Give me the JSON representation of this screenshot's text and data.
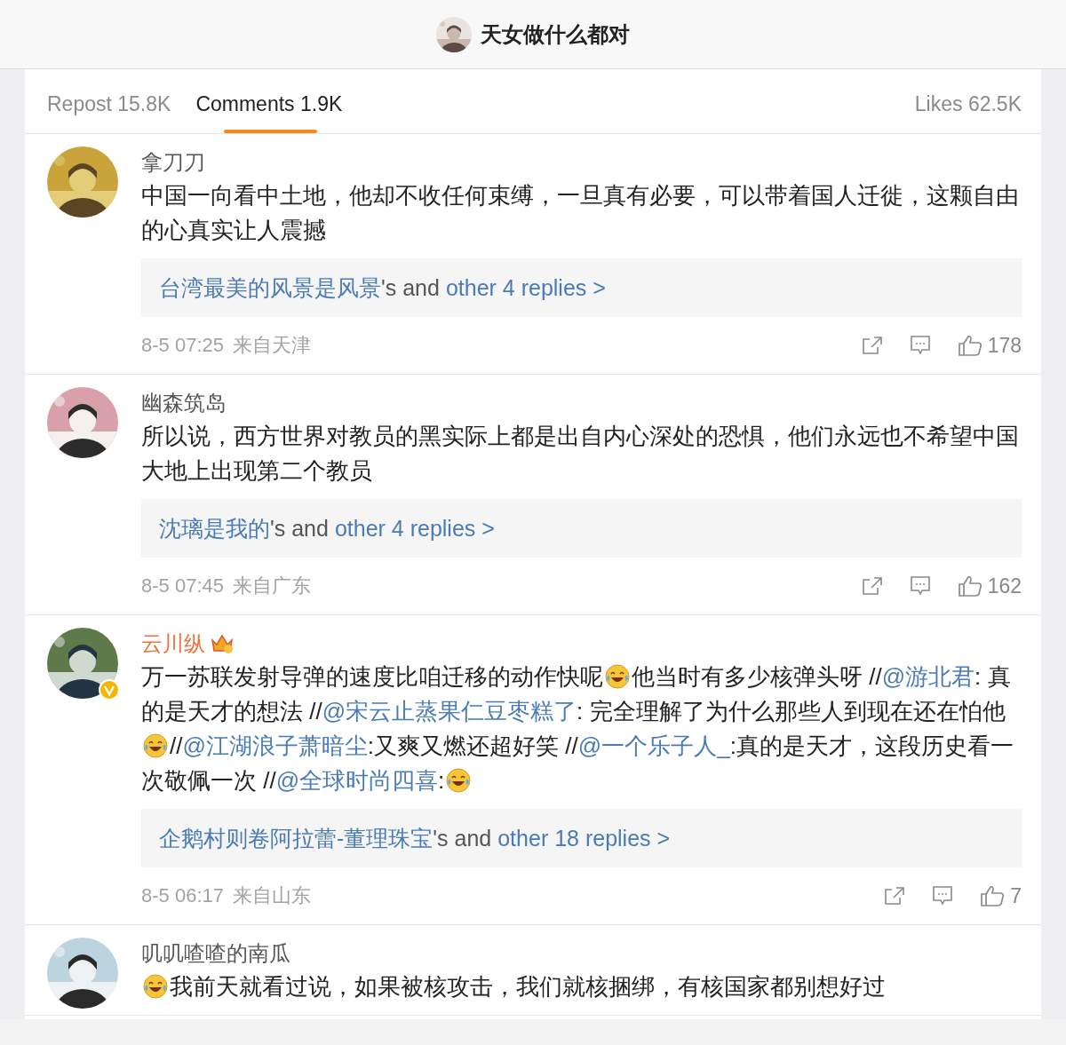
{
  "header": {
    "title": "天女做什么都对"
  },
  "tabs": [
    {
      "label": "Repost 15.8K",
      "selected": false
    },
    {
      "label": "Comments 1.9K",
      "selected": true
    },
    {
      "label": "Likes 62.5K",
      "selected": false
    }
  ],
  "comments": [
    {
      "user": "拿刀刀",
      "vip": false,
      "verified": false,
      "name_highlight": false,
      "body": [
        {
          "kind": "text",
          "text": "中国一向看中土地，他却不收任何束缚，一旦真有必要，可以带着国人迁徙，这颗自由的心真实让人震撼"
        }
      ],
      "replies": {
        "user": "台湾最美的风景是风景",
        "joiner": "'s and",
        "link": "other 4 replies >"
      },
      "time": "8-5 07:25",
      "source": "来自天津",
      "likes": "178"
    },
    {
      "user": "幽森筑岛",
      "vip": false,
      "verified": false,
      "name_highlight": false,
      "body": [
        {
          "kind": "text",
          "text": "所以说，西方世界对教员的黑实际上都是出自内心深处的恐惧，他们永远也不希望中国大地上出现第二个教员"
        }
      ],
      "replies": {
        "user": "沈璃是我的",
        "joiner": "'s and",
        "link": "other 4 replies >"
      },
      "time": "8-5 07:45",
      "source": "来自广东",
      "likes": "162"
    },
    {
      "user": "云川纵",
      "vip": true,
      "verified": true,
      "name_highlight": true,
      "body": [
        {
          "kind": "text",
          "text": "万一苏联发射导弹的速度比咱迁移的动作快呢"
        },
        {
          "kind": "emoji"
        },
        {
          "kind": "text",
          "text": "他当时有多少核弹头呀 //"
        },
        {
          "kind": "mention",
          "text": "@游北君"
        },
        {
          "kind": "text",
          "text": ": 真的是天才的想法 //"
        },
        {
          "kind": "mention",
          "text": "@宋云止蒸果仁豆枣糕了"
        },
        {
          "kind": "text",
          "text": ": 完全理解了为什么那些人到现在还在怕他"
        },
        {
          "kind": "emoji"
        },
        {
          "kind": "text",
          "text": "//"
        },
        {
          "kind": "mention",
          "text": "@江湖浪子萧暗尘"
        },
        {
          "kind": "text",
          "text": ":又爽又燃还超好笑 //"
        },
        {
          "kind": "mention",
          "text": "@一个乐子人_"
        },
        {
          "kind": "text",
          "text": ":真的是天才，这段历史看一次敬佩一次 //"
        },
        {
          "kind": "mention",
          "text": "@全球时尚四喜"
        },
        {
          "kind": "text",
          "text": ":"
        },
        {
          "kind": "emoji"
        }
      ],
      "replies": {
        "user": "企鹅村则卷阿拉蕾-董理珠宝",
        "joiner": "'s and",
        "link": "other 18 replies >"
      },
      "time": "8-5 06:17",
      "source": "来自山东",
      "likes": "7"
    },
    {
      "user": "叽叽喳喳的南瓜",
      "vip": false,
      "verified": false,
      "name_highlight": false,
      "body": [
        {
          "kind": "emoji"
        },
        {
          "kind": "text",
          "text": "我前天就看过说，如果被核攻击，我们就核捆绑，有核国家都别想好过"
        }
      ]
    }
  ]
}
